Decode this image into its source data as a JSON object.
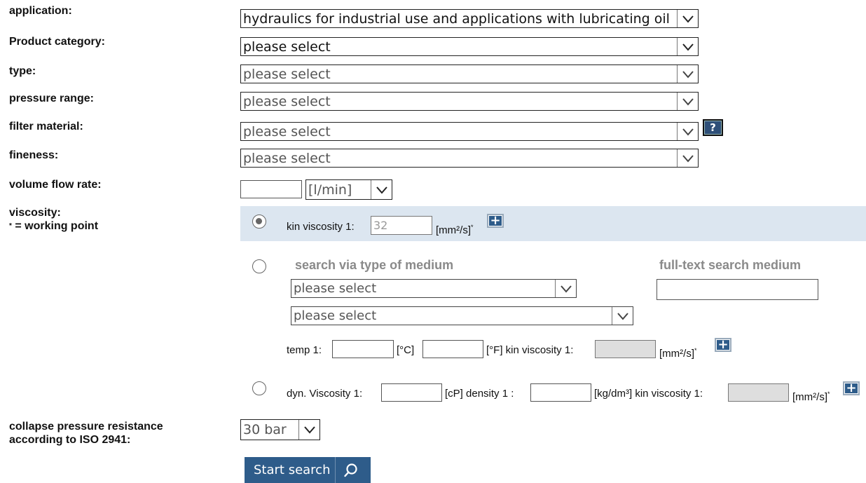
{
  "labels": {
    "application": "application:",
    "product_category": "Product category:",
    "type": "type:",
    "pressure_range": "pressure range:",
    "filter_material": "filter material:",
    "fineness": "fineness:",
    "volume_flow_rate": "volume flow rate:",
    "viscosity": "viscosity:",
    "working_point": "= working point",
    "collapse_line1": "collapse pressure resistance",
    "collapse_line2": "according to ISO 2941:"
  },
  "selects": {
    "application": "hydraulics for industrial use and applications with lubricating oil",
    "product_category": "please select",
    "type": "please select",
    "pressure_range": "please select",
    "filter_material": "please select",
    "fineness": "please select",
    "flow_unit": "[l/min]",
    "medium_type_1": "please select",
    "medium_type_2": "please select",
    "collapse_pressure": "30 bar"
  },
  "help_button": "?",
  "option1": {
    "kin_viscosity_label": "kin viscosity 1:",
    "kin_viscosity_value": "32",
    "unit": "[mm²/s]",
    "asterisk": "*"
  },
  "option2": {
    "search_type_header": "search via type of medium",
    "fulltext_header": "full-text search medium",
    "temp_label": "temp 1:",
    "celsius_unit": "[°C]",
    "fahrenheit_kin_label": "[°F] kin viscosity 1:",
    "unit": "[mm²/s]",
    "asterisk": "*"
  },
  "option3": {
    "dyn_label": "dyn. Viscosity 1:",
    "cp_density_label": "[cP] density 1 :",
    "kg_kin_label": "[kg/dm³] kin viscosity 1:",
    "unit": "[mm²/s]",
    "asterisk": "*"
  },
  "plus_symbol": "+",
  "search_button": "Start search",
  "colors": {
    "highlight_row": "#dce6f0",
    "button_bg": "#2e5c8a",
    "header_grey": "#8a8a8a"
  },
  "icons": {
    "chevron": "chevron-down-icon",
    "search": "search-icon",
    "plus": "plus-icon",
    "help": "help-icon"
  }
}
